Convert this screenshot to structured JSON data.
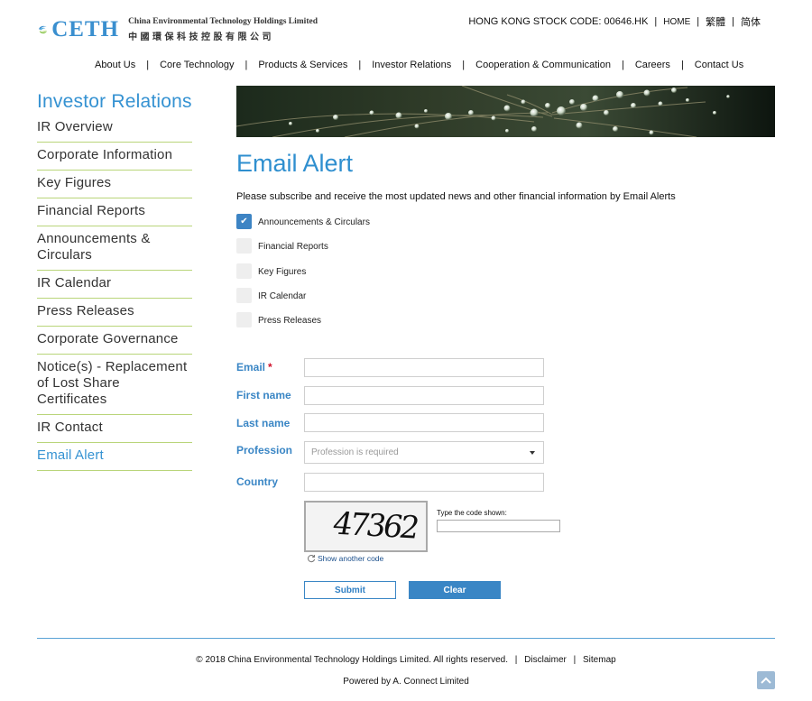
{
  "header": {
    "brand_word": "CETH",
    "company_en": "China Environmental Technology Holdings Limited",
    "company_cn": "中國環保科技控股有限公司",
    "stock_code": "HONG KONG STOCK CODE: 00646.HK",
    "lang_links": [
      {
        "label": "HOME"
      },
      {
        "label": "繁體"
      },
      {
        "label": "简体"
      }
    ],
    "separator": "|"
  },
  "nav": {
    "items": [
      {
        "label": "About Us"
      },
      {
        "label": "Core Technology"
      },
      {
        "label": "Products & Services"
      },
      {
        "label": "Investor Relations"
      },
      {
        "label": "Cooperation & Communication"
      },
      {
        "label": "Careers"
      },
      {
        "label": "Contact Us"
      }
    ]
  },
  "sidebar": {
    "title": "Investor Relations",
    "items": [
      {
        "label": "IR Overview"
      },
      {
        "label": "Corporate Information"
      },
      {
        "label": "Key Figures"
      },
      {
        "label": "Financial Reports"
      },
      {
        "label": "Announcements & Circulars"
      },
      {
        "label": "IR Calendar"
      },
      {
        "label": "Press Releases"
      },
      {
        "label": "Corporate Governance"
      },
      {
        "label": "Notice(s) - Replacement of Lost Share Certificates"
      },
      {
        "label": "IR Contact"
      },
      {
        "label": "Email Alert"
      }
    ],
    "active_index": 10
  },
  "main": {
    "title": "Email Alert",
    "intro": "Please subscribe and receive the most updated news and other financial information by Email Alerts",
    "subscriptions": [
      {
        "label": "Announcements & Circulars",
        "checked": true
      },
      {
        "label": "Financial Reports",
        "checked": false
      },
      {
        "label": "Key Figures",
        "checked": false
      },
      {
        "label": "IR Calendar",
        "checked": false
      },
      {
        "label": "Press Releases",
        "checked": false
      }
    ],
    "form": {
      "email_label": "Email",
      "required_mark": "*",
      "email_value": "",
      "first_name_label": "First name",
      "first_name_value": "",
      "last_name_label": "Last name",
      "last_name_value": "",
      "profession_label": "Profession",
      "profession_placeholder": "Profession is required",
      "country_label": "Country",
      "country_value": "",
      "captcha_code": "47362",
      "captcha_prompt": "Type the code shown:",
      "captcha_value": "",
      "refresh_label": "Show another code",
      "submit_label": "Submit",
      "clear_label": "Clear"
    }
  },
  "footer": {
    "copyright": "© 2018 China Environmental Technology Holdings Limited. All rights reserved.",
    "links": [
      {
        "label": "Disclaimer"
      },
      {
        "label": "Sitemap"
      }
    ],
    "powered_by": "Powered by A. Connect Limited"
  },
  "colors": {
    "brand_blue": "#3592d2",
    "label_blue": "#3a86c5",
    "divider_green": "#b9d57a",
    "checkbox_checked": "#3d84c4",
    "required_red": "#d0112b"
  },
  "icons": {
    "logo": "ceth-wave-leaf-logo",
    "checkbox_tick": "check-icon",
    "profession_caret": "chevron-down-icon",
    "refresh": "refresh-icon",
    "back_to_top": "chevron-up-icon"
  }
}
